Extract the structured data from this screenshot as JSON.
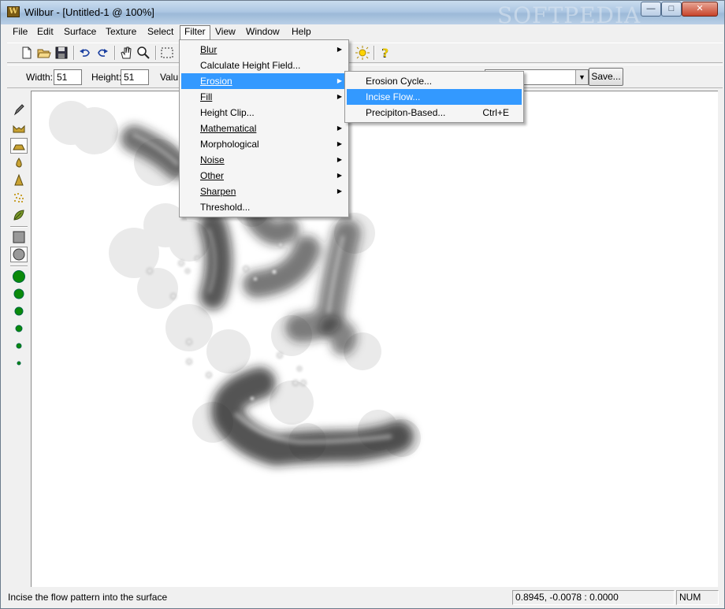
{
  "window": {
    "title": "Wilbur - [Untitled-1 @ 100%]",
    "watermark": "SOFTPEDIA"
  },
  "menubar": [
    "File",
    "Edit",
    "Surface",
    "Texture",
    "Select",
    "Filter",
    "View",
    "Window",
    "Help"
  ],
  "options": {
    "width_label": "Width:",
    "width_value": "51",
    "height_label": "Height:",
    "height_value": "51",
    "value_label": "Valu",
    "save_label": "Save..."
  },
  "filter_menu": {
    "items": [
      {
        "label": "Blur",
        "submenu": true
      },
      {
        "label": "Calculate Height Field...",
        "submenu": false
      },
      {
        "label": "Erosion",
        "submenu": true
      },
      {
        "label": "Fill",
        "submenu": true
      },
      {
        "label": "Height Clip...",
        "submenu": false
      },
      {
        "label": "Mathematical",
        "submenu": true
      },
      {
        "label": "Morphological",
        "submenu": true
      },
      {
        "label": "Noise",
        "submenu": true
      },
      {
        "label": "Other",
        "submenu": true
      },
      {
        "label": "Sharpen",
        "submenu": true
      },
      {
        "label": "Threshold...",
        "submenu": false
      }
    ]
  },
  "erosion_menu": {
    "items": [
      {
        "label": "Erosion Cycle...",
        "shortcut": ""
      },
      {
        "label": "Incise Flow...",
        "shortcut": ""
      },
      {
        "label": "Precipiton-Based...",
        "shortcut": "Ctrl+E"
      }
    ]
  },
  "statusbar": {
    "message": "Incise the flow pattern into the surface",
    "coords": "0.8945, -0.0078 : 0.0000",
    "num": "NUM"
  }
}
